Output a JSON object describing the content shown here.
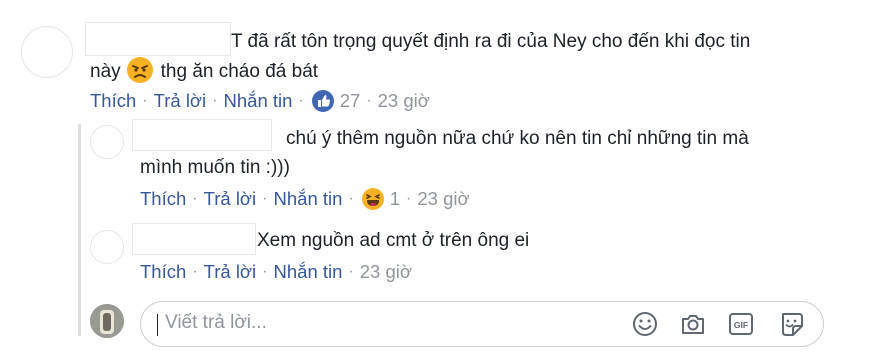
{
  "main_comment": {
    "text_line1": "T đã rất tôn trọng quyết định ra đi của Ney cho đến khi đọc tin",
    "text_line2_before": "này",
    "text_line2_after": "thg ăn cháo đá bát",
    "actions": {
      "like": "Thích",
      "reply": "Trả lời",
      "message": "Nhắn tin"
    },
    "reaction_count": "27",
    "time": "23 giờ"
  },
  "replies": [
    {
      "text_line1": "chú ý thêm nguồn nữa chứ ko nên tin chỉ những tin mà",
      "text_line2": "mình muốn tin :)))",
      "actions": {
        "like": "Thích",
        "reply": "Trả lời",
        "message": "Nhắn tin"
      },
      "reaction_count": "1",
      "time": "23 giờ"
    },
    {
      "text_line1": "Xem nguồn ad cmt ở trên ông ei",
      "actions": {
        "like": "Thích",
        "reply": "Trả lời",
        "message": "Nhắn tin"
      },
      "time": "23 giờ"
    }
  ],
  "reply_input": {
    "placeholder": "Viết trả lời..."
  },
  "colors": {
    "link": "#385898",
    "meta_gray": "#90949c",
    "like_blue": "#4267b2",
    "emoji_yellow": "#f7b125"
  },
  "icons": [
    "like-reaction-icon",
    "haha-reaction-icon",
    "angry-emoji-icon",
    "emoji-icon",
    "camera-icon",
    "gif-icon",
    "sticker-icon"
  ]
}
